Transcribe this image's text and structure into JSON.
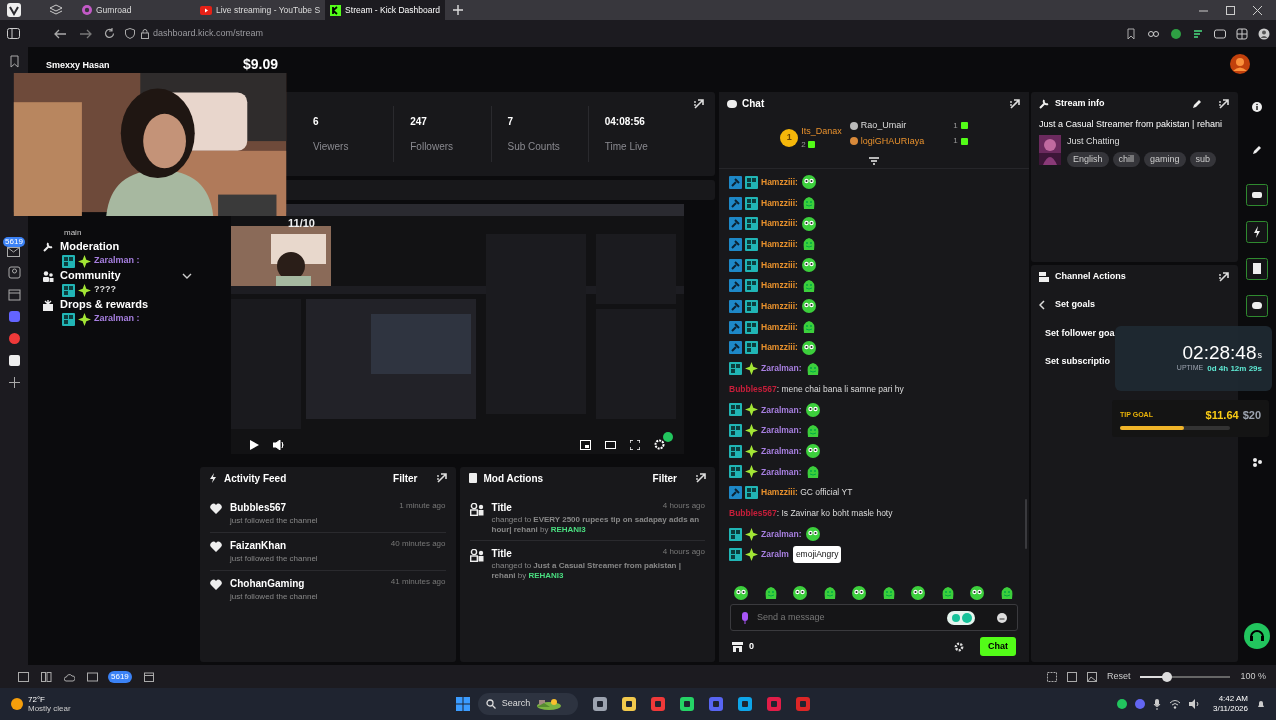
{
  "browser": {
    "tabs": [
      {
        "label": "Gumroad",
        "selected": false
      },
      {
        "label": "Live streaming - YouTube S",
        "selected": false
      },
      {
        "label": "Stream - Kick Dashboard",
        "selected": true
      }
    ],
    "url": "dashboard.kick.com/stream",
    "sidebar_badge": "5619",
    "status_badge": "5619"
  },
  "overlay": {
    "streamer": "Smexxy Hasan",
    "balance": "$9.09"
  },
  "nav": {
    "caption": "main",
    "items": [
      {
        "label": "Moderation",
        "expandable": false,
        "overlay": {
          "name": "Zaralman :",
          "color": "#a77fe0"
        }
      },
      {
        "label": "Community",
        "expandable": true,
        "overlay": {
          "name": "????"
        }
      },
      {
        "label": "Drops & rewards",
        "expandable": false,
        "overlay": {
          "name": "Zaralman :",
          "color": "#a77fe0"
        }
      }
    ]
  },
  "stats": [
    {
      "value": "6",
      "label": "Viewers"
    },
    {
      "value": "247",
      "label": "Followers"
    },
    {
      "value": "7",
      "label": "Sub Counts"
    },
    {
      "value": "04:08:56",
      "label": "Time Live"
    }
  ],
  "preview": {
    "caption": "11/10"
  },
  "activity_feed": {
    "title": "Activity Feed",
    "filter": "Filter",
    "items": [
      {
        "user": "Bubbles567",
        "action": "just followed the channel",
        "time": "1 minute ago"
      },
      {
        "user": "FaizanKhan",
        "action": "just followed the channel",
        "time": "40 minutes ago"
      },
      {
        "user": "ChohanGaming",
        "action": "just followed the channel",
        "time": "41 minutes ago"
      }
    ]
  },
  "mod_actions": {
    "title": "Mod Actions",
    "filter": "Filter",
    "items": [
      {
        "field": "Title",
        "time": "4 hours ago",
        "change": "changed to **EVERY 2500 rupees tip on sadapay adds an hour| rehani** by",
        "by": "REHANI3"
      },
      {
        "field": "Title",
        "time": "4 hours ago",
        "change": "changed to **Just a Casual Streamer from pakistan | rehani** by",
        "by": "REHANI3"
      }
    ]
  },
  "chat": {
    "title": "Chat",
    "leaders": [
      {
        "rank": "1",
        "name": "Its_Danax",
        "count": "2"
      },
      {
        "name": "Rao_Umair",
        "count": "1"
      },
      {
        "name": "logiGHAURIaya",
        "count": "1"
      }
    ],
    "messages": [
      {
        "kind": "emote",
        "name": "Hamzziii:",
        "color": "#e8912d",
        "moderator": true,
        "og": true,
        "subscriber": false
      },
      {
        "kind": "emote",
        "name": "Hamzziii:",
        "color": "#e8912d",
        "moderator": true,
        "og": true,
        "subscriber": false
      },
      {
        "kind": "emote",
        "name": "Hamzziii:",
        "color": "#e8912d",
        "moderator": true,
        "og": true,
        "subscriber": false
      },
      {
        "kind": "emote",
        "name": "Hamzziii:",
        "color": "#e8912d",
        "moderator": true,
        "og": true,
        "subscriber": false
      },
      {
        "kind": "emote",
        "name": "Hamzziii:",
        "color": "#e8912d",
        "moderator": true,
        "og": true,
        "subscriber": false
      },
      {
        "kind": "emote",
        "name": "Hamzziii:",
        "color": "#e8912d",
        "moderator": true,
        "og": true,
        "subscriber": false
      },
      {
        "kind": "emote",
        "name": "Hamzziii:",
        "color": "#e8912d",
        "moderator": true,
        "og": true,
        "subscriber": false
      },
      {
        "kind": "emote",
        "name": "Hamzziii:",
        "color": "#e8912d",
        "moderator": true,
        "og": true,
        "subscriber": false
      },
      {
        "kind": "emote",
        "name": "Hamzziii:",
        "color": "#e8912d",
        "moderator": true,
        "og": true,
        "subscriber": false
      },
      {
        "kind": "emote",
        "name": "Zaralman:",
        "color": "#a77fe0",
        "moderator": false,
        "og": true,
        "subscriber": true
      },
      {
        "kind": "text",
        "name": "Bubbles567",
        "color": "#c81e3a",
        "moderator": false,
        "og": false,
        "subscriber": false,
        "text": ": mene chai bana li samne pari hy"
      },
      {
        "kind": "emote",
        "name": "Zaralman:",
        "color": "#a77fe0",
        "moderator": false,
        "og": true,
        "subscriber": true
      },
      {
        "kind": "emote",
        "name": "Zaralman:",
        "color": "#a77fe0",
        "moderator": false,
        "og": true,
        "subscriber": true
      },
      {
        "kind": "emote",
        "name": "Zaralman:",
        "color": "#a77fe0",
        "moderator": false,
        "og": true,
        "subscriber": true
      },
      {
        "kind": "emote",
        "name": "Zaralman:",
        "color": "#a77fe0",
        "moderator": false,
        "og": true,
        "subscriber": true
      },
      {
        "kind": "text",
        "name": "Hamzziii:",
        "color": "#e8912d",
        "moderator": true,
        "og": true,
        "subscriber": false,
        "text": " GC official YT"
      },
      {
        "kind": "text",
        "name": "Bubbles567",
        "color": "#c81e3a",
        "moderator": false,
        "og": false,
        "subscriber": false,
        "text": ": Is Zavinar ko boht masle hoty"
      },
      {
        "kind": "emote",
        "name": "Zaralman:",
        "color": "#a77fe0",
        "moderator": false,
        "og": true,
        "subscriber": true
      },
      {
        "kind": "tooltip",
        "name": "Zaralm",
        "color": "#a77fe0",
        "moderator": false,
        "og": true,
        "subscriber": true,
        "tooltip": "emojiAngry"
      }
    ],
    "placeholder": "Send a message",
    "points": "0",
    "send": "Chat"
  },
  "stream_info": {
    "title": "Stream info",
    "description": "Just a Casual Streamer from pakistan | rehani",
    "category": "Just Chatting",
    "tags": [
      "English",
      "chill",
      "gaming",
      "sub"
    ]
  },
  "channel_actions": {
    "title": "Channel Actions",
    "back": "Set goals",
    "items": [
      "Set follower goa",
      "Set subscriptio"
    ]
  },
  "widgets": {
    "timer": "02:28:48",
    "timer_unit": "s",
    "uptime_label": "UPTIME",
    "uptime": "0d 4h 12m 29s",
    "tip_label": "TIP GOAL",
    "tip_raised": "$11.64",
    "tip_goal": "$20",
    "level": 0.58
  },
  "status_bar": {
    "reset": "Reset",
    "zoom": {
      "level": 0.3
    },
    "zoom_label": "100 %"
  },
  "taskbar": {
    "weather_temp": "72°F",
    "weather_text": "Mostly clear",
    "search": "Search",
    "time": "4:42 AM",
    "date": "3/11/2026"
  }
}
